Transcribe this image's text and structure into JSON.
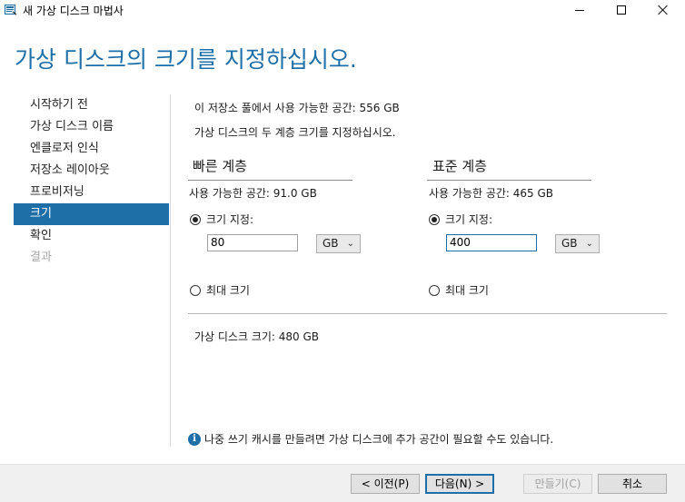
{
  "window": {
    "title": "새 가상 디스크 마법사"
  },
  "header": {
    "title": "가상 디스크의 크기를 지정하십시오."
  },
  "sidebar": {
    "items": [
      {
        "label": "시작하기 전",
        "state": "normal"
      },
      {
        "label": "가상 디스크 이름",
        "state": "normal"
      },
      {
        "label": "엔클로저 인식",
        "state": "normal"
      },
      {
        "label": "저장소 레이아웃",
        "state": "normal"
      },
      {
        "label": "프로비저닝",
        "state": "normal"
      },
      {
        "label": "크기",
        "state": "active"
      },
      {
        "label": "확인",
        "state": "normal"
      },
      {
        "label": "결과",
        "state": "disabled"
      }
    ]
  },
  "main": {
    "pool_available": "이 저장소 풀에서 사용 가능한 공간: 556 GB",
    "instruction": "가상 디스크의 두 계층 크기를 지정하십시오.",
    "fast_tier": {
      "heading": "빠른 계층",
      "available": "사용 가능한 공간: 91.0 GB",
      "specify_size_label": "크기 지정:",
      "size_value": "80",
      "unit": "GB",
      "max_size_label": "최대 크기",
      "selected": "specify"
    },
    "standard_tier": {
      "heading": "표준 계층",
      "available": "사용 가능한 공간: 465 GB",
      "specify_size_label": "크기 지정:",
      "size_value": "400",
      "unit": "GB",
      "max_size_label": "최대 크기",
      "selected": "specify"
    },
    "virtual_disk_size": "가상 디스크 크기: 480 GB",
    "info_note": "나중 쓰기 캐시를 만들려면 가상 디스크에 추가 공간이 필요할 수도 있습니다."
  },
  "footer": {
    "prev_label": "< 이전(P)",
    "next_label": "다음(N) >",
    "create_label": "만들기(C)",
    "cancel_label": "취소"
  },
  "colors": {
    "accent": "#1e6fa8"
  },
  "icons": {
    "app": "wizard-disk-icon",
    "info": "info-icon"
  }
}
